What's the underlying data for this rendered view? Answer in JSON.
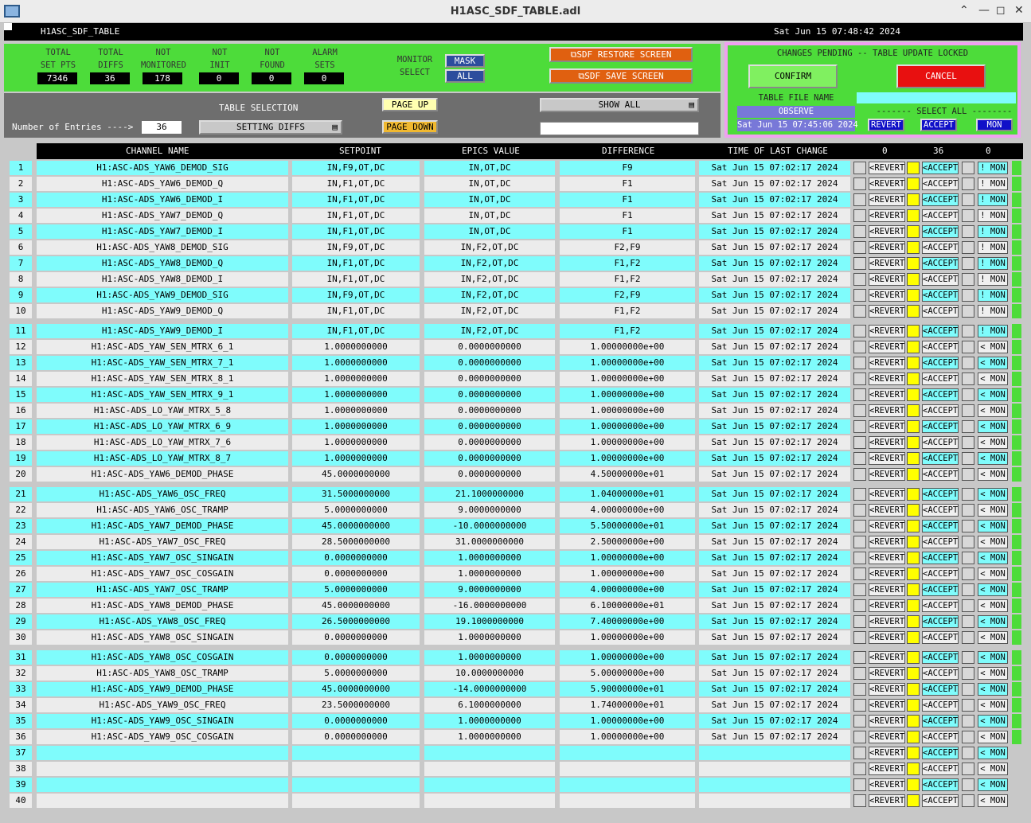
{
  "window": {
    "title": "H1ASC_SDF_TABLE.adl"
  },
  "topbar": {
    "screen_name": "H1ASC_SDF_TABLE",
    "datetime": "Sat Jun 15 07:48:42 2024"
  },
  "stats": [
    {
      "label1": "TOTAL",
      "label2": "SET PTS",
      "value": "7346"
    },
    {
      "label1": "TOTAL",
      "label2": "DIFFS",
      "value": "36"
    },
    {
      "label1": "NOT",
      "label2": "MONITORED",
      "value": "178"
    },
    {
      "label1": "NOT",
      "label2": "INIT",
      "value": "0"
    },
    {
      "label1": "NOT",
      "label2": "FOUND",
      "value": "0"
    },
    {
      "label1": "ALARM",
      "label2": "SETS",
      "value": "0"
    }
  ],
  "monitor": {
    "label1": "MONITOR",
    "label2": "SELECT",
    "mask": "MASK",
    "all": "ALL"
  },
  "screens": {
    "restore": "SDF RESTORE SCREEN",
    "save": "SDF SAVE SCREEN"
  },
  "pending": {
    "status": "CHANGES PENDING -- TABLE UPDATE LOCKED",
    "confirm": "CONFIRM",
    "cancel": "CANCEL",
    "table_file_label": "TABLE FILE NAME",
    "table_file_value": "",
    "mode": "OBSERVE",
    "file_time": "Sat Jun 15 07:45:06 2024",
    "select_all": "------- SELECT ALL --------",
    "revert": "REVERT",
    "accept": "ACCEPT",
    "mon": "MON"
  },
  "selection": {
    "table_selection_label": "TABLE SELECTION",
    "table_selection_value": "SETTING DIFFS",
    "entries_label": "Number of Entries ---->",
    "entries_value": "36",
    "page_up": "PAGE UP",
    "page_down": "PAGE DOWN",
    "show_all": "SHOW ALL",
    "filter_value": ""
  },
  "table": {
    "headers": {
      "channel": "CHANNEL NAME",
      "setpoint": "SETPOINT",
      "epics": "EPICS VALUE",
      "diff": "DIFFERENCE",
      "time": "TIME OF LAST CHANGE",
      "c1": "0",
      "c2": "36",
      "c3": "0"
    },
    "revert_label": "<REVERT",
    "accept_label": "<ACCEPT",
    "rows": [
      {
        "n": "1",
        "ch": "H1:ASC-ADS_YAW6_DEMOD_SIG",
        "sp": "IN,F9,OT,DC",
        "ev": "IN,OT,DC",
        "df": "F9",
        "t": "Sat Jun 15 07:02:17 2024",
        "mon": "! MON"
      },
      {
        "n": "2",
        "ch": "H1:ASC-ADS_YAW6_DEMOD_Q",
        "sp": "IN,F1,OT,DC",
        "ev": "IN,OT,DC",
        "df": "F1",
        "t": "Sat Jun 15 07:02:17 2024",
        "mon": "! MON"
      },
      {
        "n": "3",
        "ch": "H1:ASC-ADS_YAW6_DEMOD_I",
        "sp": "IN,F1,OT,DC",
        "ev": "IN,OT,DC",
        "df": "F1",
        "t": "Sat Jun 15 07:02:17 2024",
        "mon": "! MON"
      },
      {
        "n": "4",
        "ch": "H1:ASC-ADS_YAW7_DEMOD_Q",
        "sp": "IN,F1,OT,DC",
        "ev": "IN,OT,DC",
        "df": "F1",
        "t": "Sat Jun 15 07:02:17 2024",
        "mon": "! MON"
      },
      {
        "n": "5",
        "ch": "H1:ASC-ADS_YAW7_DEMOD_I",
        "sp": "IN,F1,OT,DC",
        "ev": "IN,OT,DC",
        "df": "F1",
        "t": "Sat Jun 15 07:02:17 2024",
        "mon": "! MON"
      },
      {
        "n": "6",
        "ch": "H1:ASC-ADS_YAW8_DEMOD_SIG",
        "sp": "IN,F9,OT,DC",
        "ev": "IN,F2,OT,DC",
        "df": "F2,F9",
        "t": "Sat Jun 15 07:02:17 2024",
        "mon": "! MON"
      },
      {
        "n": "7",
        "ch": "H1:ASC-ADS_YAW8_DEMOD_Q",
        "sp": "IN,F1,OT,DC",
        "ev": "IN,F2,OT,DC",
        "df": "F1,F2",
        "t": "Sat Jun 15 07:02:17 2024",
        "mon": "! MON"
      },
      {
        "n": "8",
        "ch": "H1:ASC-ADS_YAW8_DEMOD_I",
        "sp": "IN,F1,OT,DC",
        "ev": "IN,F2,OT,DC",
        "df": "F1,F2",
        "t": "Sat Jun 15 07:02:17 2024",
        "mon": "! MON"
      },
      {
        "n": "9",
        "ch": "H1:ASC-ADS_YAW9_DEMOD_SIG",
        "sp": "IN,F9,OT,DC",
        "ev": "IN,F2,OT,DC",
        "df": "F2,F9",
        "t": "Sat Jun 15 07:02:17 2024",
        "mon": "! MON"
      },
      {
        "n": "10",
        "ch": "H1:ASC-ADS_YAW9_DEMOD_Q",
        "sp": "IN,F1,OT,DC",
        "ev": "IN,F2,OT,DC",
        "df": "F1,F2",
        "t": "Sat Jun 15 07:02:17 2024",
        "mon": "! MON"
      },
      {
        "n": "11",
        "ch": "H1:ASC-ADS_YAW9_DEMOD_I",
        "sp": "IN,F1,OT,DC",
        "ev": "IN,F2,OT,DC",
        "df": "F1,F2",
        "t": "Sat Jun 15 07:02:17 2024",
        "mon": "! MON"
      },
      {
        "n": "12",
        "ch": "H1:ASC-ADS_YAW_SEN_MTRX_6_1",
        "sp": "1.0000000000",
        "ev": "0.0000000000",
        "df": "1.00000000e+00",
        "t": "Sat Jun 15 07:02:17 2024",
        "mon": "< MON"
      },
      {
        "n": "13",
        "ch": "H1:ASC-ADS_YAW_SEN_MTRX_7_1",
        "sp": "1.0000000000",
        "ev": "0.0000000000",
        "df": "1.00000000e+00",
        "t": "Sat Jun 15 07:02:17 2024",
        "mon": "< MON"
      },
      {
        "n": "14",
        "ch": "H1:ASC-ADS_YAW_SEN_MTRX_8_1",
        "sp": "1.0000000000",
        "ev": "0.0000000000",
        "df": "1.00000000e+00",
        "t": "Sat Jun 15 07:02:17 2024",
        "mon": "< MON"
      },
      {
        "n": "15",
        "ch": "H1:ASC-ADS_YAW_SEN_MTRX_9_1",
        "sp": "1.0000000000",
        "ev": "0.0000000000",
        "df": "1.00000000e+00",
        "t": "Sat Jun 15 07:02:17 2024",
        "mon": "< MON"
      },
      {
        "n": "16",
        "ch": "H1:ASC-ADS_LO_YAW_MTRX_5_8",
        "sp": "1.0000000000",
        "ev": "0.0000000000",
        "df": "1.00000000e+00",
        "t": "Sat Jun 15 07:02:17 2024",
        "mon": "< MON"
      },
      {
        "n": "17",
        "ch": "H1:ASC-ADS_LO_YAW_MTRX_6_9",
        "sp": "1.0000000000",
        "ev": "0.0000000000",
        "df": "1.00000000e+00",
        "t": "Sat Jun 15 07:02:17 2024",
        "mon": "< MON"
      },
      {
        "n": "18",
        "ch": "H1:ASC-ADS_LO_YAW_MTRX_7_6",
        "sp": "1.0000000000",
        "ev": "0.0000000000",
        "df": "1.00000000e+00",
        "t": "Sat Jun 15 07:02:17 2024",
        "mon": "< MON"
      },
      {
        "n": "19",
        "ch": "H1:ASC-ADS_LO_YAW_MTRX_8_7",
        "sp": "1.0000000000",
        "ev": "0.0000000000",
        "df": "1.00000000e+00",
        "t": "Sat Jun 15 07:02:17 2024",
        "mon": "< MON"
      },
      {
        "n": "20",
        "ch": "H1:ASC-ADS_YAW6_DEMOD_PHASE",
        "sp": "45.0000000000",
        "ev": "0.0000000000",
        "df": "4.50000000e+01",
        "t": "Sat Jun 15 07:02:17 2024",
        "mon": "< MON"
      },
      {
        "n": "21",
        "ch": "H1:ASC-ADS_YAW6_OSC_FREQ",
        "sp": "31.5000000000",
        "ev": "21.1000000000",
        "df": "1.04000000e+01",
        "t": "Sat Jun 15 07:02:17 2024",
        "mon": "< MON"
      },
      {
        "n": "22",
        "ch": "H1:ASC-ADS_YAW6_OSC_TRAMP",
        "sp": "5.0000000000",
        "ev": "9.0000000000",
        "df": "4.00000000e+00",
        "t": "Sat Jun 15 07:02:17 2024",
        "mon": "< MON"
      },
      {
        "n": "23",
        "ch": "H1:ASC-ADS_YAW7_DEMOD_PHASE",
        "sp": "45.0000000000",
        "ev": "-10.0000000000",
        "df": "5.50000000e+01",
        "t": "Sat Jun 15 07:02:17 2024",
        "mon": "< MON"
      },
      {
        "n": "24",
        "ch": "H1:ASC-ADS_YAW7_OSC_FREQ",
        "sp": "28.5000000000",
        "ev": "31.0000000000",
        "df": "2.50000000e+00",
        "t": "Sat Jun 15 07:02:17 2024",
        "mon": "< MON"
      },
      {
        "n": "25",
        "ch": "H1:ASC-ADS_YAW7_OSC_SINGAIN",
        "sp": "0.0000000000",
        "ev": "1.0000000000",
        "df": "1.00000000e+00",
        "t": "Sat Jun 15 07:02:17 2024",
        "mon": "< MON"
      },
      {
        "n": "26",
        "ch": "H1:ASC-ADS_YAW7_OSC_COSGAIN",
        "sp": "0.0000000000",
        "ev": "1.0000000000",
        "df": "1.00000000e+00",
        "t": "Sat Jun 15 07:02:17 2024",
        "mon": "< MON"
      },
      {
        "n": "27",
        "ch": "H1:ASC-ADS_YAW7_OSC_TRAMP",
        "sp": "5.0000000000",
        "ev": "9.0000000000",
        "df": "4.00000000e+00",
        "t": "Sat Jun 15 07:02:17 2024",
        "mon": "< MON"
      },
      {
        "n": "28",
        "ch": "H1:ASC-ADS_YAW8_DEMOD_PHASE",
        "sp": "45.0000000000",
        "ev": "-16.0000000000",
        "df": "6.10000000e+01",
        "t": "Sat Jun 15 07:02:17 2024",
        "mon": "< MON"
      },
      {
        "n": "29",
        "ch": "H1:ASC-ADS_YAW8_OSC_FREQ",
        "sp": "26.5000000000",
        "ev": "19.1000000000",
        "df": "7.40000000e+00",
        "t": "Sat Jun 15 07:02:17 2024",
        "mon": "< MON"
      },
      {
        "n": "30",
        "ch": "H1:ASC-ADS_YAW8_OSC_SINGAIN",
        "sp": "0.0000000000",
        "ev": "1.0000000000",
        "df": "1.00000000e+00",
        "t": "Sat Jun 15 07:02:17 2024",
        "mon": "< MON"
      },
      {
        "n": "31",
        "ch": "H1:ASC-ADS_YAW8_OSC_COSGAIN",
        "sp": "0.0000000000",
        "ev": "1.0000000000",
        "df": "1.00000000e+00",
        "t": "Sat Jun 15 07:02:17 2024",
        "mon": "< MON"
      },
      {
        "n": "32",
        "ch": "H1:ASC-ADS_YAW8_OSC_TRAMP",
        "sp": "5.0000000000",
        "ev": "10.0000000000",
        "df": "5.00000000e+00",
        "t": "Sat Jun 15 07:02:17 2024",
        "mon": "< MON"
      },
      {
        "n": "33",
        "ch": "H1:ASC-ADS_YAW9_DEMOD_PHASE",
        "sp": "45.0000000000",
        "ev": "-14.0000000000",
        "df": "5.90000000e+01",
        "t": "Sat Jun 15 07:02:17 2024",
        "mon": "< MON"
      },
      {
        "n": "34",
        "ch": "H1:ASC-ADS_YAW9_OSC_FREQ",
        "sp": "23.5000000000",
        "ev": "6.1000000000",
        "df": "1.74000000e+01",
        "t": "Sat Jun 15 07:02:17 2024",
        "mon": "< MON"
      },
      {
        "n": "35",
        "ch": "H1:ASC-ADS_YAW9_OSC_SINGAIN",
        "sp": "0.0000000000",
        "ev": "1.0000000000",
        "df": "1.00000000e+00",
        "t": "Sat Jun 15 07:02:17 2024",
        "mon": "< MON"
      },
      {
        "n": "36",
        "ch": "H1:ASC-ADS_YAW9_OSC_COSGAIN",
        "sp": "0.0000000000",
        "ev": "1.0000000000",
        "df": "1.00000000e+00",
        "t": "Sat Jun 15 07:02:17 2024",
        "mon": "< MON"
      },
      {
        "n": "37",
        "ch": "",
        "sp": "",
        "ev": "",
        "df": "",
        "t": "",
        "mon": "< MON"
      },
      {
        "n": "38",
        "ch": "",
        "sp": "",
        "ev": "",
        "df": "",
        "t": "",
        "mon": "< MON"
      },
      {
        "n": "39",
        "ch": "",
        "sp": "",
        "ev": "",
        "df": "",
        "t": "",
        "mon": "< MON"
      },
      {
        "n": "40",
        "ch": "",
        "sp": "",
        "ev": "",
        "df": "",
        "t": "",
        "mon": "< MON"
      }
    ]
  },
  "colors": {
    "cyan": "#7ffcfc",
    "light": "#ececec",
    "green": "#4ddc3a",
    "orange": "#e06010",
    "red": "#e81010",
    "blue": "#1010c8"
  }
}
